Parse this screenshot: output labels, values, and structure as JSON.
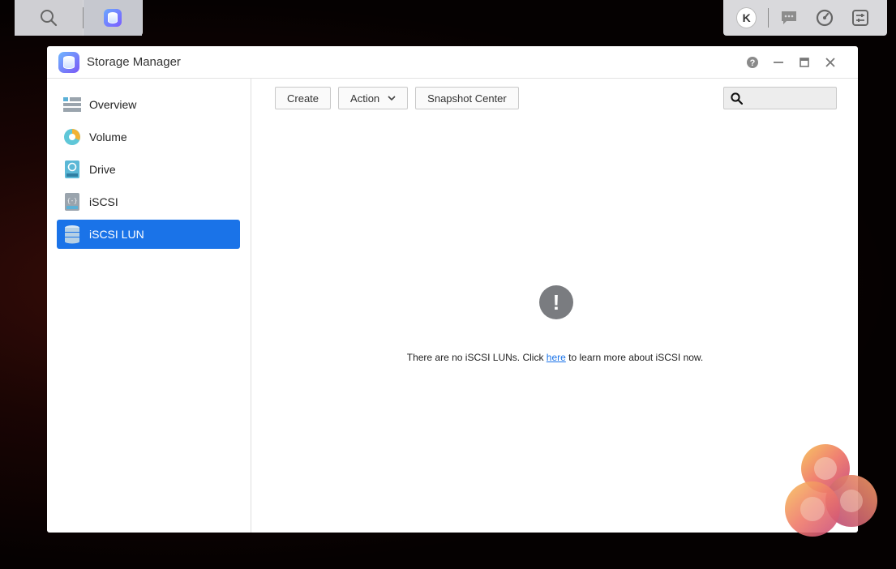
{
  "taskbar": {
    "avatar_initial": "K"
  },
  "window": {
    "title": "Storage Manager"
  },
  "sidebar": {
    "items": [
      {
        "label": "Overview"
      },
      {
        "label": "Volume"
      },
      {
        "label": "Drive"
      },
      {
        "label": "iSCSI"
      },
      {
        "label": "iSCSI LUN"
      }
    ],
    "active_index": 4
  },
  "toolbar": {
    "create_label": "Create",
    "action_label": "Action",
    "snapshot_label": "Snapshot Center"
  },
  "search": {
    "placeholder": "",
    "value": ""
  },
  "empty_state": {
    "icon_glyph": "!",
    "text_before": "There are no iSCSI LUNs. Click ",
    "link_text": "here",
    "text_after": " to learn more about iSCSI now."
  },
  "colors": {
    "accent": "#1a73e8",
    "empty_icon": "#7a7c80"
  }
}
